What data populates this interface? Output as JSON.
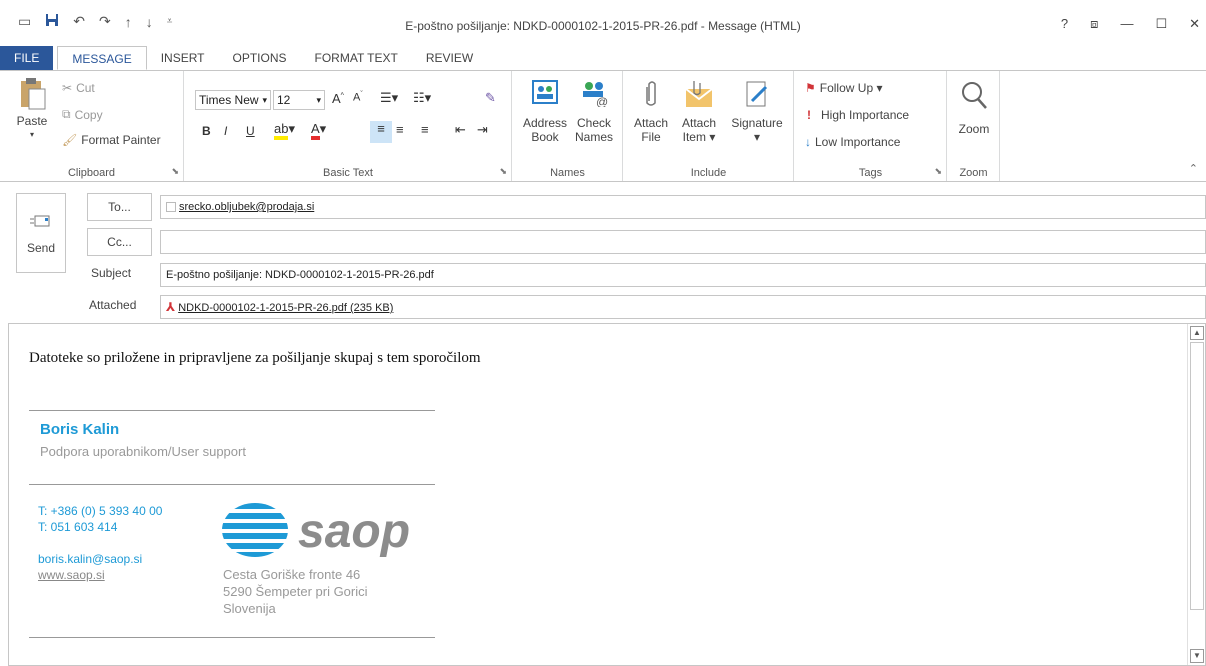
{
  "window": {
    "title": "E-poštno pošiljanje: NDKD-0000102-1-2015-PR-26.pdf - Message (HTML)",
    "controls": [
      "?",
      "⧈",
      "—",
      "☐",
      "✕"
    ]
  },
  "tabs": [
    "FILE",
    "MESSAGE",
    "INSERT",
    "OPTIONS",
    "FORMAT TEXT",
    "REVIEW"
  ],
  "ribbon": {
    "clipboard": {
      "label": "Clipboard",
      "paste": "Paste",
      "cut": "Cut",
      "copy": "Copy",
      "format_painter": "Format Painter"
    },
    "basic_text": {
      "label": "Basic Text",
      "font_name": "Times New",
      "font_size": "12"
    },
    "names": {
      "label": "Names",
      "address_book_1": "Address",
      "address_book_2": "Book",
      "check_names_1": "Check",
      "check_names_2": "Names"
    },
    "include": {
      "label": "Include",
      "attach_file_1": "Attach",
      "attach_file_2": "File",
      "attach_item_1": "Attach",
      "attach_item_2": "Item ▾",
      "signature_1": "Signature",
      "signature_2": "▾"
    },
    "tags": {
      "label": "Tags",
      "follow_up": "Follow Up ▾",
      "high": "High Importance",
      "low": "Low Importance"
    },
    "zoom": {
      "label": "Zoom",
      "button": "Zoom"
    }
  },
  "compose": {
    "send": "Send",
    "to_button": "To...",
    "cc_button": "Cc...",
    "subject_label": "Subject",
    "attached_label": "Attached",
    "to_value": "srecko.obljubek@prodaja.si",
    "cc_value": "",
    "subject_value": "E-poštno pošiljanje: NDKD-0000102-1-2015-PR-26.pdf",
    "attachment": "NDKD-0000102-1-2015-PR-26.pdf (235 KB)"
  },
  "body": {
    "text": "Datoteke so priložene in pripravljene za pošiljanje skupaj s tem sporočilom",
    "signature": {
      "name": "Boris Kalin",
      "role": "Podpora uporabnikom/User support",
      "phone1": "T: +386 (0) 5 393 40 00",
      "phone2": "T: 051 603 414",
      "email": "boris.kalin@saop.si",
      "web": "www.saop.si",
      "logo_text": "saop",
      "addr1": "Cesta Goriške fronte 46",
      "addr2": "5290 Šempeter pri Gorici",
      "addr3": "Slovenija"
    }
  },
  "colors": {
    "accent": "#2b579a",
    "sig_blue": "#1e9ad6",
    "follow_flag": "#d13438"
  }
}
